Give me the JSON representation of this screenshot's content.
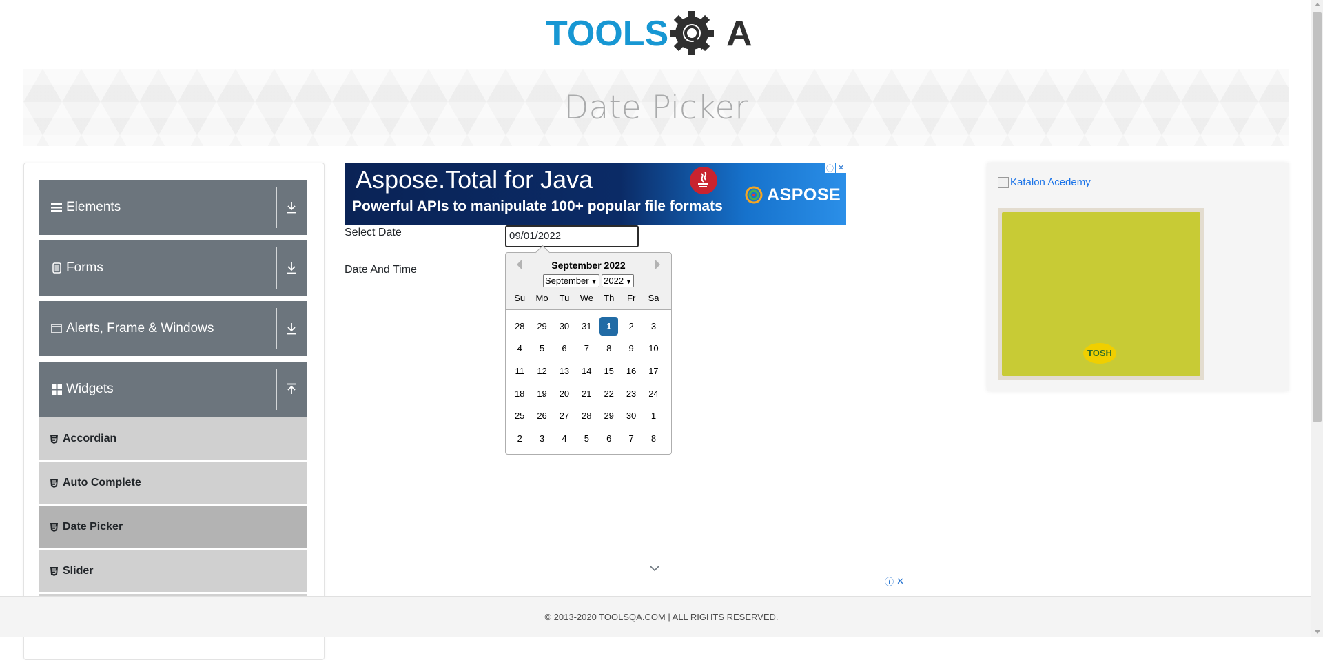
{
  "logo": {
    "text_left": "TOOLS",
    "text_right": "A"
  },
  "page_title": "Date Picker",
  "sidebar": {
    "groups": [
      {
        "label": "Elements",
        "icon": "hamburger-icon",
        "expanded": false
      },
      {
        "label": "Forms",
        "icon": "document-icon",
        "expanded": false
      },
      {
        "label": "Alerts, Frame & Windows",
        "icon": "window-icon",
        "expanded": false
      },
      {
        "label": "Widgets",
        "icon": "widgets-icon",
        "expanded": true
      }
    ],
    "widget_items": [
      {
        "label": "Accordian",
        "active": false
      },
      {
        "label": "Auto Complete",
        "active": false
      },
      {
        "label": "Date Picker",
        "active": true
      },
      {
        "label": "Slider",
        "active": false
      }
    ]
  },
  "ad_top": {
    "title": "Aspose.Total for Java",
    "subtitle": "Powerful APIs to manipulate 100+ popular file formats",
    "brand": "ASPOSE"
  },
  "form": {
    "select_date_label": "Select Date",
    "select_date_value": "09/01/2022",
    "date_time_label": "Date And Time"
  },
  "calendar": {
    "header": "September 2022",
    "month_select": "September",
    "year_select": "2022",
    "weekdays": [
      "Su",
      "Mo",
      "Tu",
      "We",
      "Th",
      "Fr",
      "Sa"
    ],
    "weeks": [
      [
        "28",
        "29",
        "30",
        "31",
        "1",
        "2",
        "3"
      ],
      [
        "4",
        "5",
        "6",
        "7",
        "8",
        "9",
        "10"
      ],
      [
        "11",
        "12",
        "13",
        "14",
        "15",
        "16",
        "17"
      ],
      [
        "18",
        "19",
        "20",
        "21",
        "22",
        "23",
        "24"
      ],
      [
        "25",
        "26",
        "27",
        "28",
        "29",
        "30",
        "1"
      ],
      [
        "2",
        "3",
        "4",
        "5",
        "6",
        "7",
        "8"
      ]
    ],
    "selected": "1"
  },
  "right_ad": {
    "alt_text": "Katalon Acedemy",
    "badge": "TOSH"
  },
  "footer": {
    "text": "© 2013-2020 TOOLSQA.COM | ALL RIGHTS RESERVED."
  },
  "colors": {
    "sidebar_header": "#6c757d",
    "selected_day": "#216ba5",
    "logo_blue": "#1797d3",
    "logo_dark": "#333333"
  }
}
